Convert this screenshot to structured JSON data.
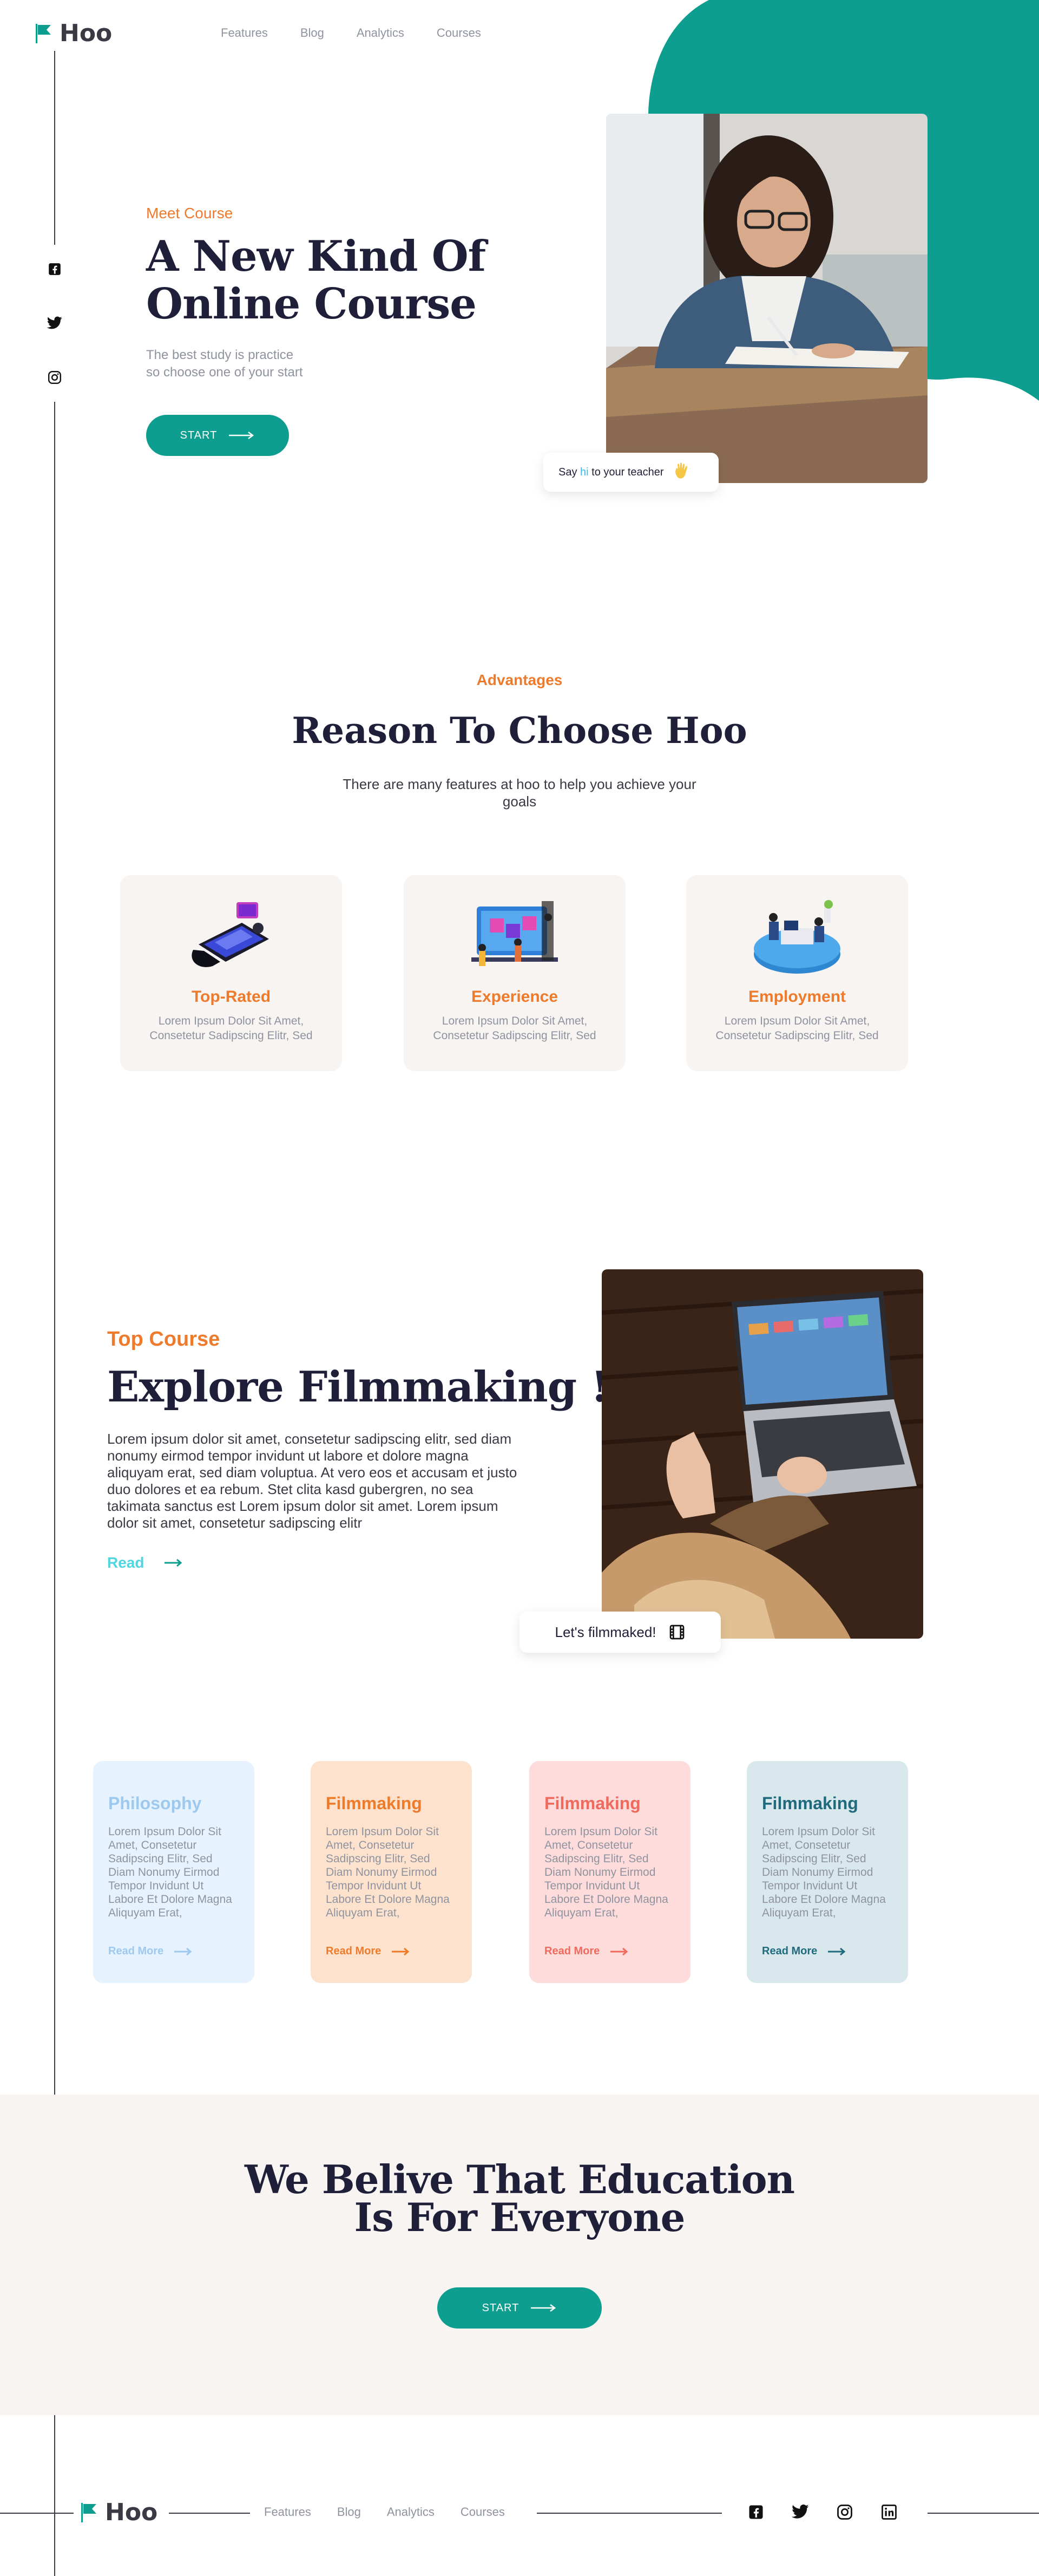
{
  "colors": {
    "brand": "#0e9e8f",
    "accent": "#ee7a2c",
    "heading": "#1f1f3a",
    "muted": "#8f93a0",
    "link": "#4fd6e2",
    "band": "#f7f4f1"
  },
  "header": {
    "logo_text": "Hoo",
    "nav": [
      "Features",
      "Blog",
      "Analytics",
      "Courses"
    ]
  },
  "social_icons": [
    "facebook-icon",
    "twitter-icon",
    "instagram-icon",
    "linkedin-icon"
  ],
  "hero": {
    "eyebrow": "Meet Course",
    "title_line1": "A New Kind Of",
    "title_line2": "Online Course",
    "sub_line1": "The best study is practice",
    "sub_line2": "so choose one of your start",
    "button": "START",
    "tooltip_prefix": "Say ",
    "tooltip_hi": "hi",
    "tooltip_suffix": " to your teacher"
  },
  "advantages": {
    "eyebrow": "Advantages",
    "title": "Reason To Choose Hoo",
    "subtitle": "There are many features at hoo to help you achieve your goals",
    "cards": [
      {
        "title": "Top-Rated",
        "text": "Lorem Ipsum Dolor Sit Amet, Consetetur Sadipscing Elitr, Sed"
      },
      {
        "title": "Experience",
        "text": "Lorem Ipsum Dolor Sit Amet, Consetetur Sadipscing Elitr, Sed"
      },
      {
        "title": "Employment",
        "text": "Lorem Ipsum Dolor Sit Amet, Consetetur Sadipscing Elitr, Sed"
      }
    ]
  },
  "top_course": {
    "eyebrow": "Top Course",
    "title": "Explore Filmmaking !",
    "body": "Lorem ipsum dolor sit amet, consetetur sadipscing elitr, sed diam nonumy eirmod tempor invidunt ut labore et dolore magna aliquyam erat, sed diam voluptua. At vero eos et accusam et justo duo dolores et ea rebum. Stet clita kasd gubergren, no sea takimata sanctus est Lorem ipsum dolor sit amet. Lorem ipsum dolor sit amet, consetetur sadipscing elitr",
    "read": "Read",
    "tooltip": "Let's filmmaked!"
  },
  "courses": [
    {
      "title": "Philosophy",
      "text": "Lorem Ipsum Dolor Sit Amet, Consetetur Sadipscing Elitr, Sed Diam Nonumy Eirmod Tempor Invidunt Ut Labore Et Dolore Magna Aliquyam Erat,",
      "link": "Read More",
      "bg": "#e6f2fd",
      "color": "#9ec9ef"
    },
    {
      "title": "Filmmaking",
      "text": "Lorem Ipsum Dolor Sit Amet, Consetetur Sadipscing Elitr, Sed Diam Nonumy Eirmod Tempor Invidunt Ut Labore Et Dolore Magna Aliquyam Erat,",
      "link": "Read More",
      "bg": "#fde3cd",
      "color": "#ee7a2c"
    },
    {
      "title": "Filmmaking",
      "text": "Lorem Ipsum Dolor Sit Amet, Consetetur Sadipscing Elitr, Sed Diam Nonumy Eirmod Tempor Invidunt Ut Labore Et Dolore Magna Aliquyam Erat,",
      "link": "Read More",
      "bg": "#fddcdb",
      "color": "#ee6a5c"
    },
    {
      "title": "Filmmaking",
      "text": "Lorem Ipsum Dolor Sit Amet, Consetetur Sadipscing Elitr, Sed Diam Nonumy Eirmod Tempor Invidunt Ut Labore Et Dolore Magna Aliquyam Erat,",
      "link": "Read More",
      "bg": "#d8e8ec",
      "color": "#1f6a7c"
    }
  ],
  "cta": {
    "title_line1": "We Belive That Education",
    "title_line2": "Is For Everyone",
    "button": "START"
  },
  "footer": {
    "logo_text": "Hoo",
    "nav": [
      "Features",
      "Blog",
      "Analytics",
      "Courses"
    ]
  }
}
